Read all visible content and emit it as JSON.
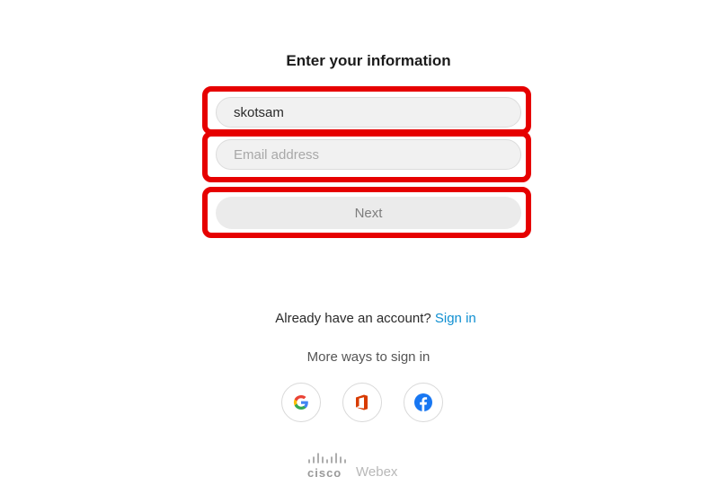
{
  "form": {
    "heading": "Enter your information",
    "username_value": "skotsam",
    "email_placeholder": "Email address",
    "next_label": "Next",
    "highlight_color": "#e60000"
  },
  "signin": {
    "prompt": "Already have an account?",
    "link_label": "Sign in",
    "link_color": "#0f8fd1"
  },
  "more_ways": {
    "label": "More ways to sign in",
    "providers": [
      {
        "name": "google",
        "icon": "google-icon"
      },
      {
        "name": "office",
        "icon": "office-icon"
      },
      {
        "name": "facebook",
        "icon": "facebook-icon"
      }
    ]
  },
  "footer": {
    "brand": "cisco",
    "product": "Webex"
  }
}
